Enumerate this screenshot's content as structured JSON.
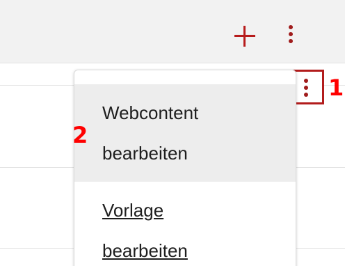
{
  "toolbar": {
    "add_icon": "plus-icon",
    "more_icon": "kebab-vertical-icon",
    "accent_color": "#b71c1c"
  },
  "row_actions": {
    "more_icon": "kebab-vertical-icon"
  },
  "annotations": {
    "label_1": "1",
    "label_2": "2",
    "color": "#ff0000"
  },
  "menu": {
    "items": [
      {
        "line1": "Webcontent",
        "line2": "bearbeiten",
        "highlighted": true
      },
      {
        "line1": "Vorlage",
        "line2": "bearbeiten",
        "highlighted": false
      }
    ]
  }
}
